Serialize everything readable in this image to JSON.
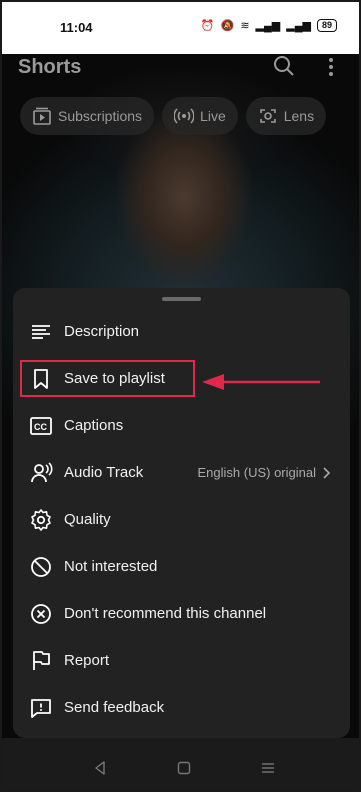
{
  "status": {
    "time": "11:04",
    "battery": "89"
  },
  "header": {
    "title": "Shorts"
  },
  "chips": [
    {
      "label": "Subscriptions",
      "icon": "subscriptions-icon"
    },
    {
      "label": "Live",
      "icon": "live-icon"
    },
    {
      "label": "Lens",
      "icon": "lens-icon"
    }
  ],
  "menu": {
    "items": [
      {
        "label": "Description",
        "icon": "description-icon"
      },
      {
        "label": "Save to playlist",
        "icon": "bookmark-icon"
      },
      {
        "label": "Captions",
        "icon": "captions-icon"
      },
      {
        "label": "Audio Track",
        "icon": "audio-track-icon",
        "meta": "English (US) original"
      },
      {
        "label": "Quality",
        "icon": "gear-icon"
      },
      {
        "label": "Not interested",
        "icon": "block-icon"
      },
      {
        "label": "Don't recommend this channel",
        "icon": "x-circle-icon"
      },
      {
        "label": "Report",
        "icon": "flag-icon"
      },
      {
        "label": "Send feedback",
        "icon": "feedback-icon"
      }
    ]
  },
  "annotation": {
    "color": "#e0284b"
  }
}
